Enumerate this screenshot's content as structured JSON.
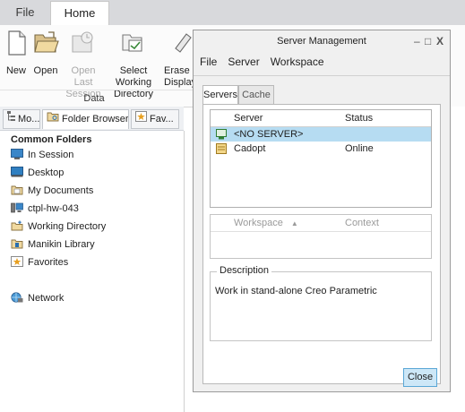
{
  "ribbon": {
    "tabs": [
      {
        "label": "File"
      },
      {
        "label": "Home"
      }
    ],
    "buttons": [
      {
        "label": "New",
        "icon": "new-file-icon",
        "enabled": true
      },
      {
        "label": "Open",
        "icon": "open-folder-icon",
        "enabled": true
      },
      {
        "label": "Open Last\nSession",
        "icon": "open-last-session-icon",
        "enabled": false
      },
      {
        "label": "Select Working\nDirectory",
        "icon": "select-directory-icon",
        "enabled": true
      },
      {
        "label": "Erase N\nDisplay",
        "icon": "erase-icon",
        "enabled": true
      }
    ],
    "group_label": "Data"
  },
  "left_panel": {
    "tabs": [
      {
        "label": "Mo...",
        "icon": "model-tree-icon"
      },
      {
        "label": "Folder Browser",
        "icon": "folder-browser-icon",
        "active": true
      },
      {
        "label": "Fav...",
        "icon": "favorites-icon"
      }
    ],
    "section_title": "Common Folders",
    "folders": [
      {
        "label": "In Session",
        "icon": "in-session-icon"
      },
      {
        "label": "Desktop",
        "icon": "desktop-icon"
      },
      {
        "label": "My Documents",
        "icon": "my-documents-icon"
      },
      {
        "label": "ctpl-hw-043",
        "icon": "computer-icon"
      },
      {
        "label": "Working Directory",
        "icon": "working-directory-icon"
      },
      {
        "label": "Manikin Library",
        "icon": "manikin-library-icon"
      },
      {
        "label": "Favorites",
        "icon": "favorites-icon"
      },
      {
        "label": "Network",
        "icon": "network-icon"
      }
    ]
  },
  "dialog": {
    "title": "Server Management",
    "window_buttons": {
      "minimize": "–",
      "maximize": "□",
      "close": "X"
    },
    "menu": [
      "File",
      "Server",
      "Workspace"
    ],
    "tabs": [
      {
        "label": "Servers",
        "active": true
      },
      {
        "label": "Cache",
        "active": false
      }
    ],
    "servers_table": {
      "columns": [
        "Server",
        "Status"
      ],
      "rows": [
        {
          "server": "<NO SERVER>",
          "status": "",
          "icon": "no-server-icon",
          "selected": true
        },
        {
          "server": "Cadopt",
          "status": "Online",
          "icon": "server-database-icon",
          "selected": false
        }
      ]
    },
    "workspace_table": {
      "columns": [
        "Workspace",
        "Context"
      ],
      "sort_indicator": "▲"
    },
    "description": {
      "legend": "Description",
      "text": "Work in stand-alone Creo Parametric"
    },
    "close_label": "Close"
  },
  "colors": {
    "selection": "#b6dcf2",
    "close_button_bg": "#cde7f7",
    "close_button_border": "#5aa7d6",
    "tab_bar_bg": "#d8d9dc"
  }
}
